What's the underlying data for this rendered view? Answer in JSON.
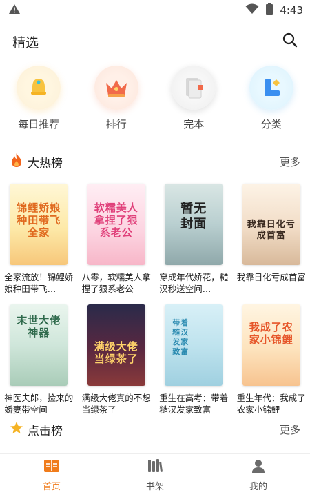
{
  "status_bar": {
    "time": "4:43"
  },
  "header": {
    "title": "精选"
  },
  "quick_nav": [
    {
      "label": "每日推荐",
      "icon": "bell-icon"
    },
    {
      "label": "排行",
      "icon": "crown-icon"
    },
    {
      "label": "完本",
      "icon": "book-stack-icon"
    },
    {
      "label": "分类",
      "icon": "category-icon"
    }
  ],
  "hot_section": {
    "title": "大热榜",
    "more": "更多",
    "icon": "flame-icon"
  },
  "books": [
    {
      "title": "全家流放！锦鲤娇娘种田带飞…",
      "cover_text": "锦鲤娇娘种田带飞全家"
    },
    {
      "title": "八零，软糯美人拿捏了狠系老公",
      "cover_text": "软糯美人拿捏了狠系老公"
    },
    {
      "title": "穿成年代娇花，糙汉秒送空间…",
      "cover_text": "暂无封面"
    },
    {
      "title": "我靠日化亏成首富",
      "cover_text": "我靠日化亏成首富"
    },
    {
      "title": "神医夫郎，捡来的娇妻带空间",
      "cover_text": "末世大佬神器"
    },
    {
      "title": "满级大佬真的不想当绿茶了",
      "cover_text": "满级大佬当绿茶了"
    },
    {
      "title": "重生在高考：带着糙汉发家致富",
      "cover_text": "带着糙汉发家致富"
    },
    {
      "title": "重生年代：我成了农家小锦鲤",
      "cover_text": "我成了农家小锦鲤"
    }
  ],
  "click_section": {
    "title": "点击榜",
    "more": "更多",
    "icon": "star-icon"
  },
  "tabs": [
    {
      "label": "首页",
      "icon": "home-book-icon",
      "active": true
    },
    {
      "label": "书架",
      "icon": "bookshelf-icon",
      "active": false
    },
    {
      "label": "我的",
      "icon": "user-icon",
      "active": false
    }
  ],
  "colors": {
    "accent": "#f07c1c",
    "star": "#f5b324",
    "flame": "#f2641c"
  }
}
